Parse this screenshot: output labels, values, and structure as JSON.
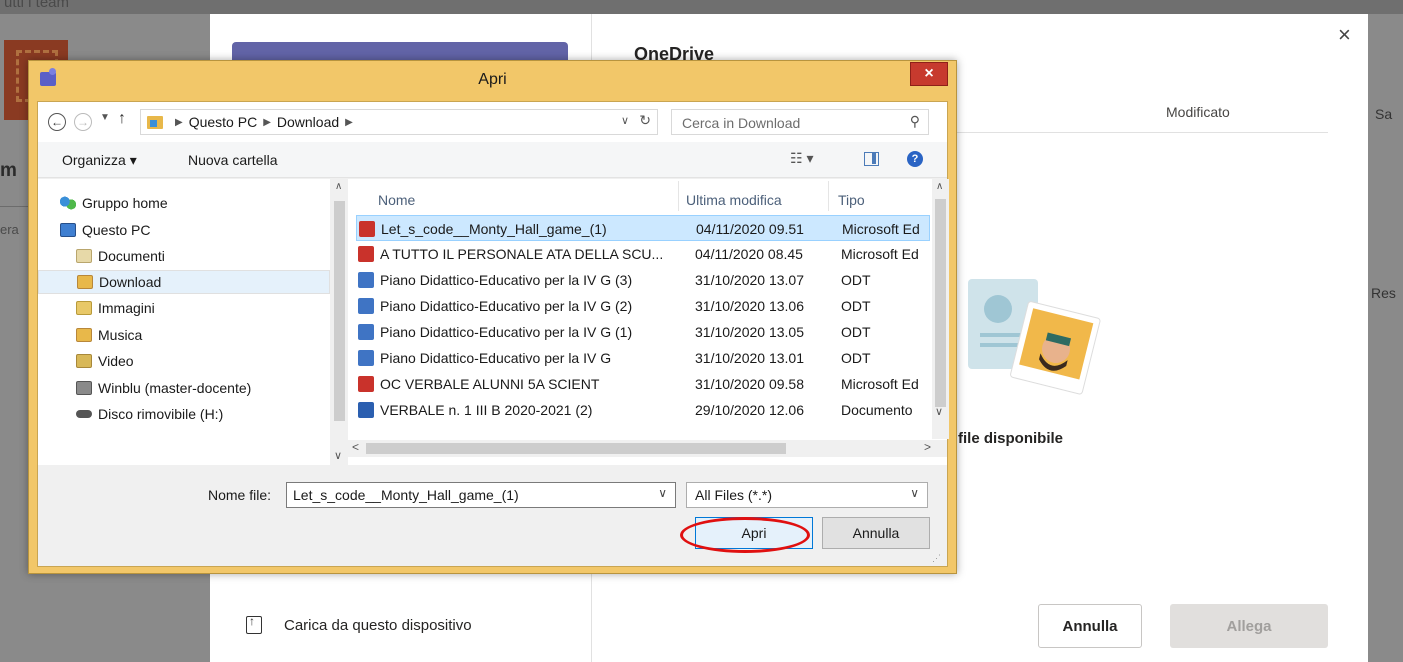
{
  "background": {
    "top_text": "utti i team",
    "frag_m": "m",
    "frag_era": "era",
    "frag_sa": "Sa",
    "frag_res": "Res"
  },
  "onedrive": {
    "title": "OneDrive",
    "close_glyph": "×",
    "column_modified": "Modificato",
    "empty_text": "file disponibile",
    "upload_label": "Carica da questo dispositivo",
    "cancel_label": "Annulla",
    "attach_label": "Allega"
  },
  "open_dialog": {
    "title": "Apri",
    "close_glyph": "×",
    "address": {
      "segments": [
        "Questo PC",
        "Download"
      ]
    },
    "search_placeholder": "Cerca in Download",
    "toolbar": {
      "organize": "Organizza ▾",
      "new_folder": "Nuova cartella",
      "help": "?"
    },
    "nav_items": [
      {
        "label": "Gruppo home",
        "icon": "homegroup-icon"
      },
      {
        "label": "Questo PC",
        "icon": "computer-icon"
      },
      {
        "label": "Documenti",
        "icon": "documents-folder-icon"
      },
      {
        "label": "Download",
        "icon": "downloads-folder-icon",
        "selected": true
      },
      {
        "label": "Immagini",
        "icon": "pictures-folder-icon"
      },
      {
        "label": "Musica",
        "icon": "music-folder-icon"
      },
      {
        "label": "Video",
        "icon": "videos-folder-icon"
      },
      {
        "label": "Winblu (master-docente)",
        "icon": "network-drive-icon"
      },
      {
        "label": "Disco rimovibile (H:)",
        "icon": "removable-disk-icon"
      }
    ],
    "columns": {
      "name": "Nome",
      "modified": "Ultima modifica",
      "type": "Tipo"
    },
    "files": [
      {
        "name": "Let_s_code__Monty_Hall_game_(1)",
        "modified": "04/11/2020 09.51",
        "type": "Microsoft Ed",
        "icon": "pdf",
        "selected": true
      },
      {
        "name": "A TUTTO IL PERSONALE ATA DELLA SCU...",
        "modified": "04/11/2020 08.45",
        "type": "Microsoft Ed",
        "icon": "pdf"
      },
      {
        "name": "Piano Didattico-Educativo per la IV G (3)",
        "modified": "31/10/2020 13.07",
        "type": "ODT",
        "icon": "odt"
      },
      {
        "name": "Piano Didattico-Educativo per la IV G (2)",
        "modified": "31/10/2020 13.06",
        "type": "ODT",
        "icon": "odt"
      },
      {
        "name": "Piano Didattico-Educativo per la IV G (1)",
        "modified": "31/10/2020 13.05",
        "type": "ODT",
        "icon": "odt"
      },
      {
        "name": "Piano Didattico-Educativo per la IV G",
        "modified": "31/10/2020 13.01",
        "type": "ODT",
        "icon": "odt"
      },
      {
        "name": "OC VERBALE ALUNNI 5A  SCIENT",
        "modified": "31/10/2020 09.58",
        "type": "Microsoft Ed",
        "icon": "pdf"
      },
      {
        "name": "VERBALE n. 1 III B 2020-2021 (2)",
        "modified": "29/10/2020 12.06",
        "type": "Documento",
        "icon": "doc"
      }
    ],
    "filename_label": "Nome file:",
    "filename_value": "Let_s_code__Monty_Hall_game_(1)",
    "filetype_value": "All Files (*.*)",
    "open_label": "Apri",
    "cancel_label": "Annulla"
  },
  "colors": {
    "window_frame": "#f2c769",
    "teams_purple": "#6264a7",
    "highlight_red": "#e01010",
    "selection_blue": "#cce8ff"
  }
}
